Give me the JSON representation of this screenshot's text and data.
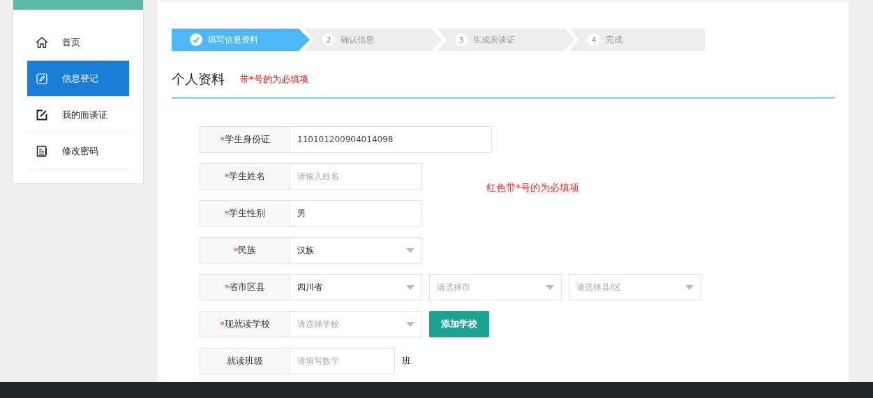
{
  "sidebar": {
    "items": [
      {
        "label": "首页",
        "selected": false
      },
      {
        "label": "信息登记",
        "selected": true
      },
      {
        "label": "我的面谈证",
        "selected": false
      },
      {
        "label": "修改密码",
        "selected": false
      }
    ]
  },
  "steps": [
    {
      "label": "填写信息资料",
      "done": true,
      "selected": true
    },
    {
      "number": "2",
      "label": "确认信息",
      "done": false,
      "selected": false
    },
    {
      "number": "3",
      "label": "生成面谈证",
      "done": false,
      "selected": false
    },
    {
      "number": "4",
      "label": "完成",
      "done": false,
      "selected": false
    }
  ],
  "section": {
    "title": "个人资料",
    "hint": "带*号的为必填项"
  },
  "note": "红色带*号的为必填项",
  "rows": [
    {
      "mark": "*",
      "label": "学生身份证",
      "controls": [
        {
          "kind": "input",
          "value": "110101200904014098"
        }
      ]
    },
    {
      "mark": "*",
      "label": "学生姓名",
      "controls": [
        {
          "kind": "input",
          "placeholder": "请输入姓名"
        }
      ]
    },
    {
      "mark": "*",
      "label": "学生性别",
      "controls": [
        {
          "kind": "input",
          "value": "男"
        }
      ]
    },
    {
      "mark": "*",
      "label": "民族",
      "controls": [
        {
          "kind": "select",
          "value": "汉族"
        }
      ]
    },
    {
      "mark": "*",
      "label": "省市区县",
      "controls": [
        {
          "kind": "select",
          "value": "四川省"
        },
        {
          "kind": "select",
          "placeholder": "请选择市"
        },
        {
          "kind": "select",
          "placeholder": "请选择县/区"
        }
      ]
    },
    {
      "mark": "*",
      "label": "现就读学校",
      "controls": [
        {
          "kind": "select",
          "placeholder": "请选择学校"
        },
        {
          "kind": "button",
          "label": "添加学校"
        }
      ]
    },
    {
      "label": "就读班级",
      "controls": [
        {
          "kind": "input",
          "placeholder": "请填写数字"
        },
        {
          "kind": "suffix",
          "label": "班"
        }
      ]
    }
  ]
}
